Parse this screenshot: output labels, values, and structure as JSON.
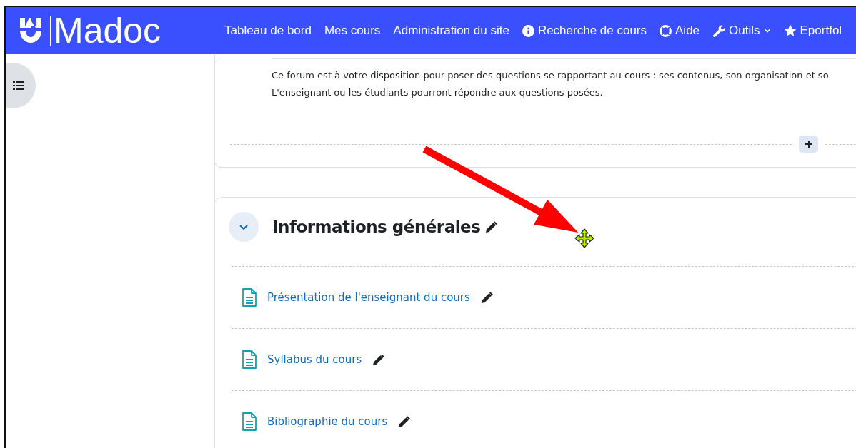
{
  "brand": {
    "name": "Madoc"
  },
  "nav": [
    {
      "label": "Tableau de bord",
      "kind": "plain",
      "dropdown": false
    },
    {
      "label": "Mes cours",
      "kind": "plain",
      "dropdown": false
    },
    {
      "label": "Administration du site",
      "kind": "plain",
      "dropdown": false
    },
    {
      "label": "Recherche de cours",
      "kind": "info",
      "dropdown": false
    },
    {
      "label": "Aide",
      "kind": "help",
      "dropdown": false
    },
    {
      "label": "Outils",
      "kind": "tools",
      "dropdown": true
    },
    {
      "label": "Eportfol",
      "kind": "favorite",
      "dropdown": false
    }
  ],
  "forum_description": [
    "Ce forum est à votre disposition pour poser des questions se rapportant au cours : ses contenus, son organisation et so",
    "L'enseignant ou les étudiants pourront répondre aux questions posées."
  ],
  "section": {
    "title": "Informations générales",
    "expanded": true,
    "activities": [
      {
        "name": "Présentation de l'enseignant du cours"
      },
      {
        "name": "Syllabus du cours"
      },
      {
        "name": "Bibliographie du cours"
      }
    ]
  }
}
